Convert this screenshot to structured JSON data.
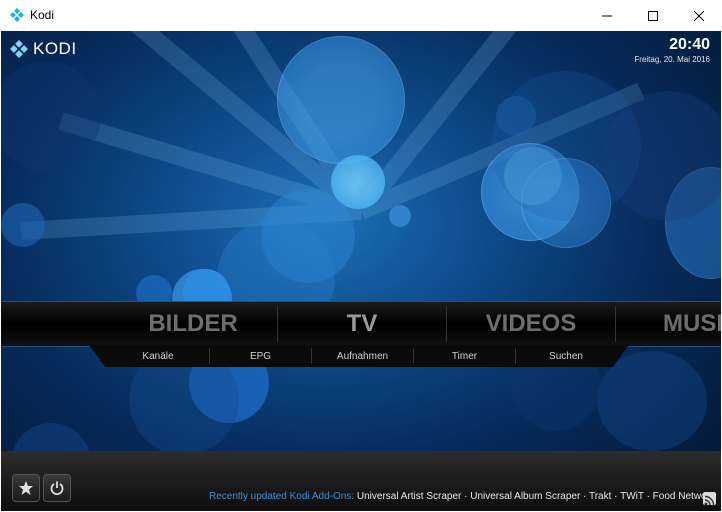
{
  "window": {
    "title": "Kodi"
  },
  "kodi": {
    "logo": "KODI",
    "time": "20:40",
    "date": "Freitag, 20. Mai 2016"
  },
  "main_menu": {
    "items": [
      "BILDER",
      "TV",
      "VIDEOS",
      "MUSI"
    ],
    "active_index": 1
  },
  "sub_menu": {
    "items": [
      "Kanäle",
      "EPG",
      "Aufnahmen",
      "Timer",
      "Suchen"
    ]
  },
  "ticker": {
    "label": "Recently updated Kodi Add-Ons:",
    "text": "Universal Artist Scraper · Universal Album Scraper · Trakt · TWiT · Food Network C"
  },
  "icons": {
    "favourites": "star-icon",
    "power": "power-icon",
    "rss": "rss-icon"
  },
  "colors": {
    "accent": "#3a8fdb",
    "background": "#0d4a8a"
  }
}
